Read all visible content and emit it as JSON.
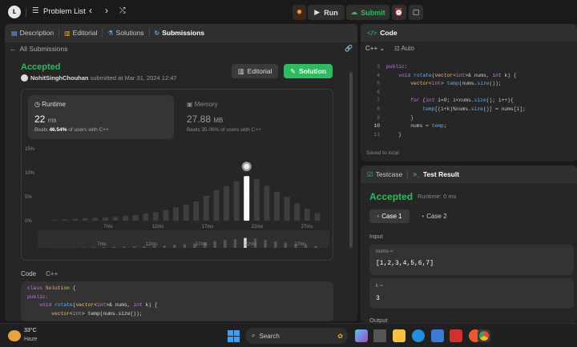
{
  "topbar": {
    "problem_list": "Problem List",
    "run": "Run",
    "submit": "Submit"
  },
  "left_tabs": [
    {
      "label": "Description"
    },
    {
      "label": "Editorial"
    },
    {
      "label": "Solutions"
    },
    {
      "label": "Submissions"
    }
  ],
  "submission": {
    "back": "All Submissions",
    "status": "Accepted",
    "user": "NohitSinghChouhan",
    "submitted_at": "submitted at Mar 31, 2024 12:47",
    "editorial_btn": "Editorial",
    "solution_btn": "Solution",
    "runtime_label": "Runtime",
    "runtime_value": "22",
    "runtime_unit": "ms",
    "runtime_beats_prefix": "Beats",
    "runtime_beats": "46.54%",
    "runtime_beats_suffix": "of users with C++",
    "memory_label": "Memory",
    "memory_value": "27.88",
    "memory_unit": "MB",
    "memory_beats_prefix": "Beats",
    "memory_beats": "35.06%",
    "memory_beats_suffix": "of users with C++",
    "code_label": "Code",
    "code_lang": "C++"
  },
  "chart_data": {
    "type": "bar",
    "y_ticks": [
      "15%",
      "10%",
      "5%",
      "0%"
    ],
    "x_ticks": [
      "7ms",
      "12ms",
      "17ms",
      "22ms",
      "27ms"
    ],
    "overview_ticks": [
      "7ms",
      "12ms",
      "17ms",
      "22ms",
      "27ms"
    ],
    "ylim": [
      0,
      15
    ],
    "values": [
      0.2,
      0.3,
      0.4,
      0.5,
      0.6,
      0.7,
      0.8,
      1.0,
      1.2,
      1.5,
      1.8,
      2.2,
      2.8,
      3.4,
      4.0,
      5.2,
      6.4,
      7.2,
      8.2,
      9.3,
      8.6,
      7.3,
      6.0,
      4.9,
      3.6,
      2.5,
      1.6
    ],
    "highlight_index": 19,
    "highlight_color": "#ffffff"
  },
  "left_code": [
    "class Solution {",
    "public:",
    "    void rotate(vector<int>& nums, int k) {",
    "        vector<int> temp(nums.size());"
  ],
  "editor": {
    "title": "Code",
    "lang": "C++",
    "mode": "Auto",
    "line_numbers": [
      "3",
      "4",
      "5",
      "6",
      "7",
      "8",
      "9",
      "10",
      "11"
    ],
    "lines": [
      "public:",
      "    void rotate(vector<int>& nums, int k) {",
      "        vector<int> temp(nums.size());",
      "",
      "        for (int i=0; i<nums.size(); i++){",
      "            temp[(i+k)%nums.size()] = nums[i];",
      "        }",
      "",
      "        nums = temp;",
      "    }"
    ],
    "saved": "Saved to local"
  },
  "result": {
    "tab_testcase": "Testcase",
    "tab_result": "Test Result",
    "status": "Accepted",
    "runtime": "Runtime: 0 ms",
    "case1": "Case 1",
    "case2": "Case 2",
    "input_label": "Input",
    "nums_label": "nums =",
    "nums_value": "[1,2,3,4,5,6,7]",
    "k_label": "k =",
    "k_value": "3",
    "output_label": "Output"
  },
  "taskbar": {
    "temp": "33°C",
    "weather": "Haze",
    "search": "Search"
  },
  "colors": {
    "accent_green": "#2cbb5d",
    "accent_orange": "#ffa116",
    "bg": "#1a1a1a",
    "panel": "#262626"
  }
}
